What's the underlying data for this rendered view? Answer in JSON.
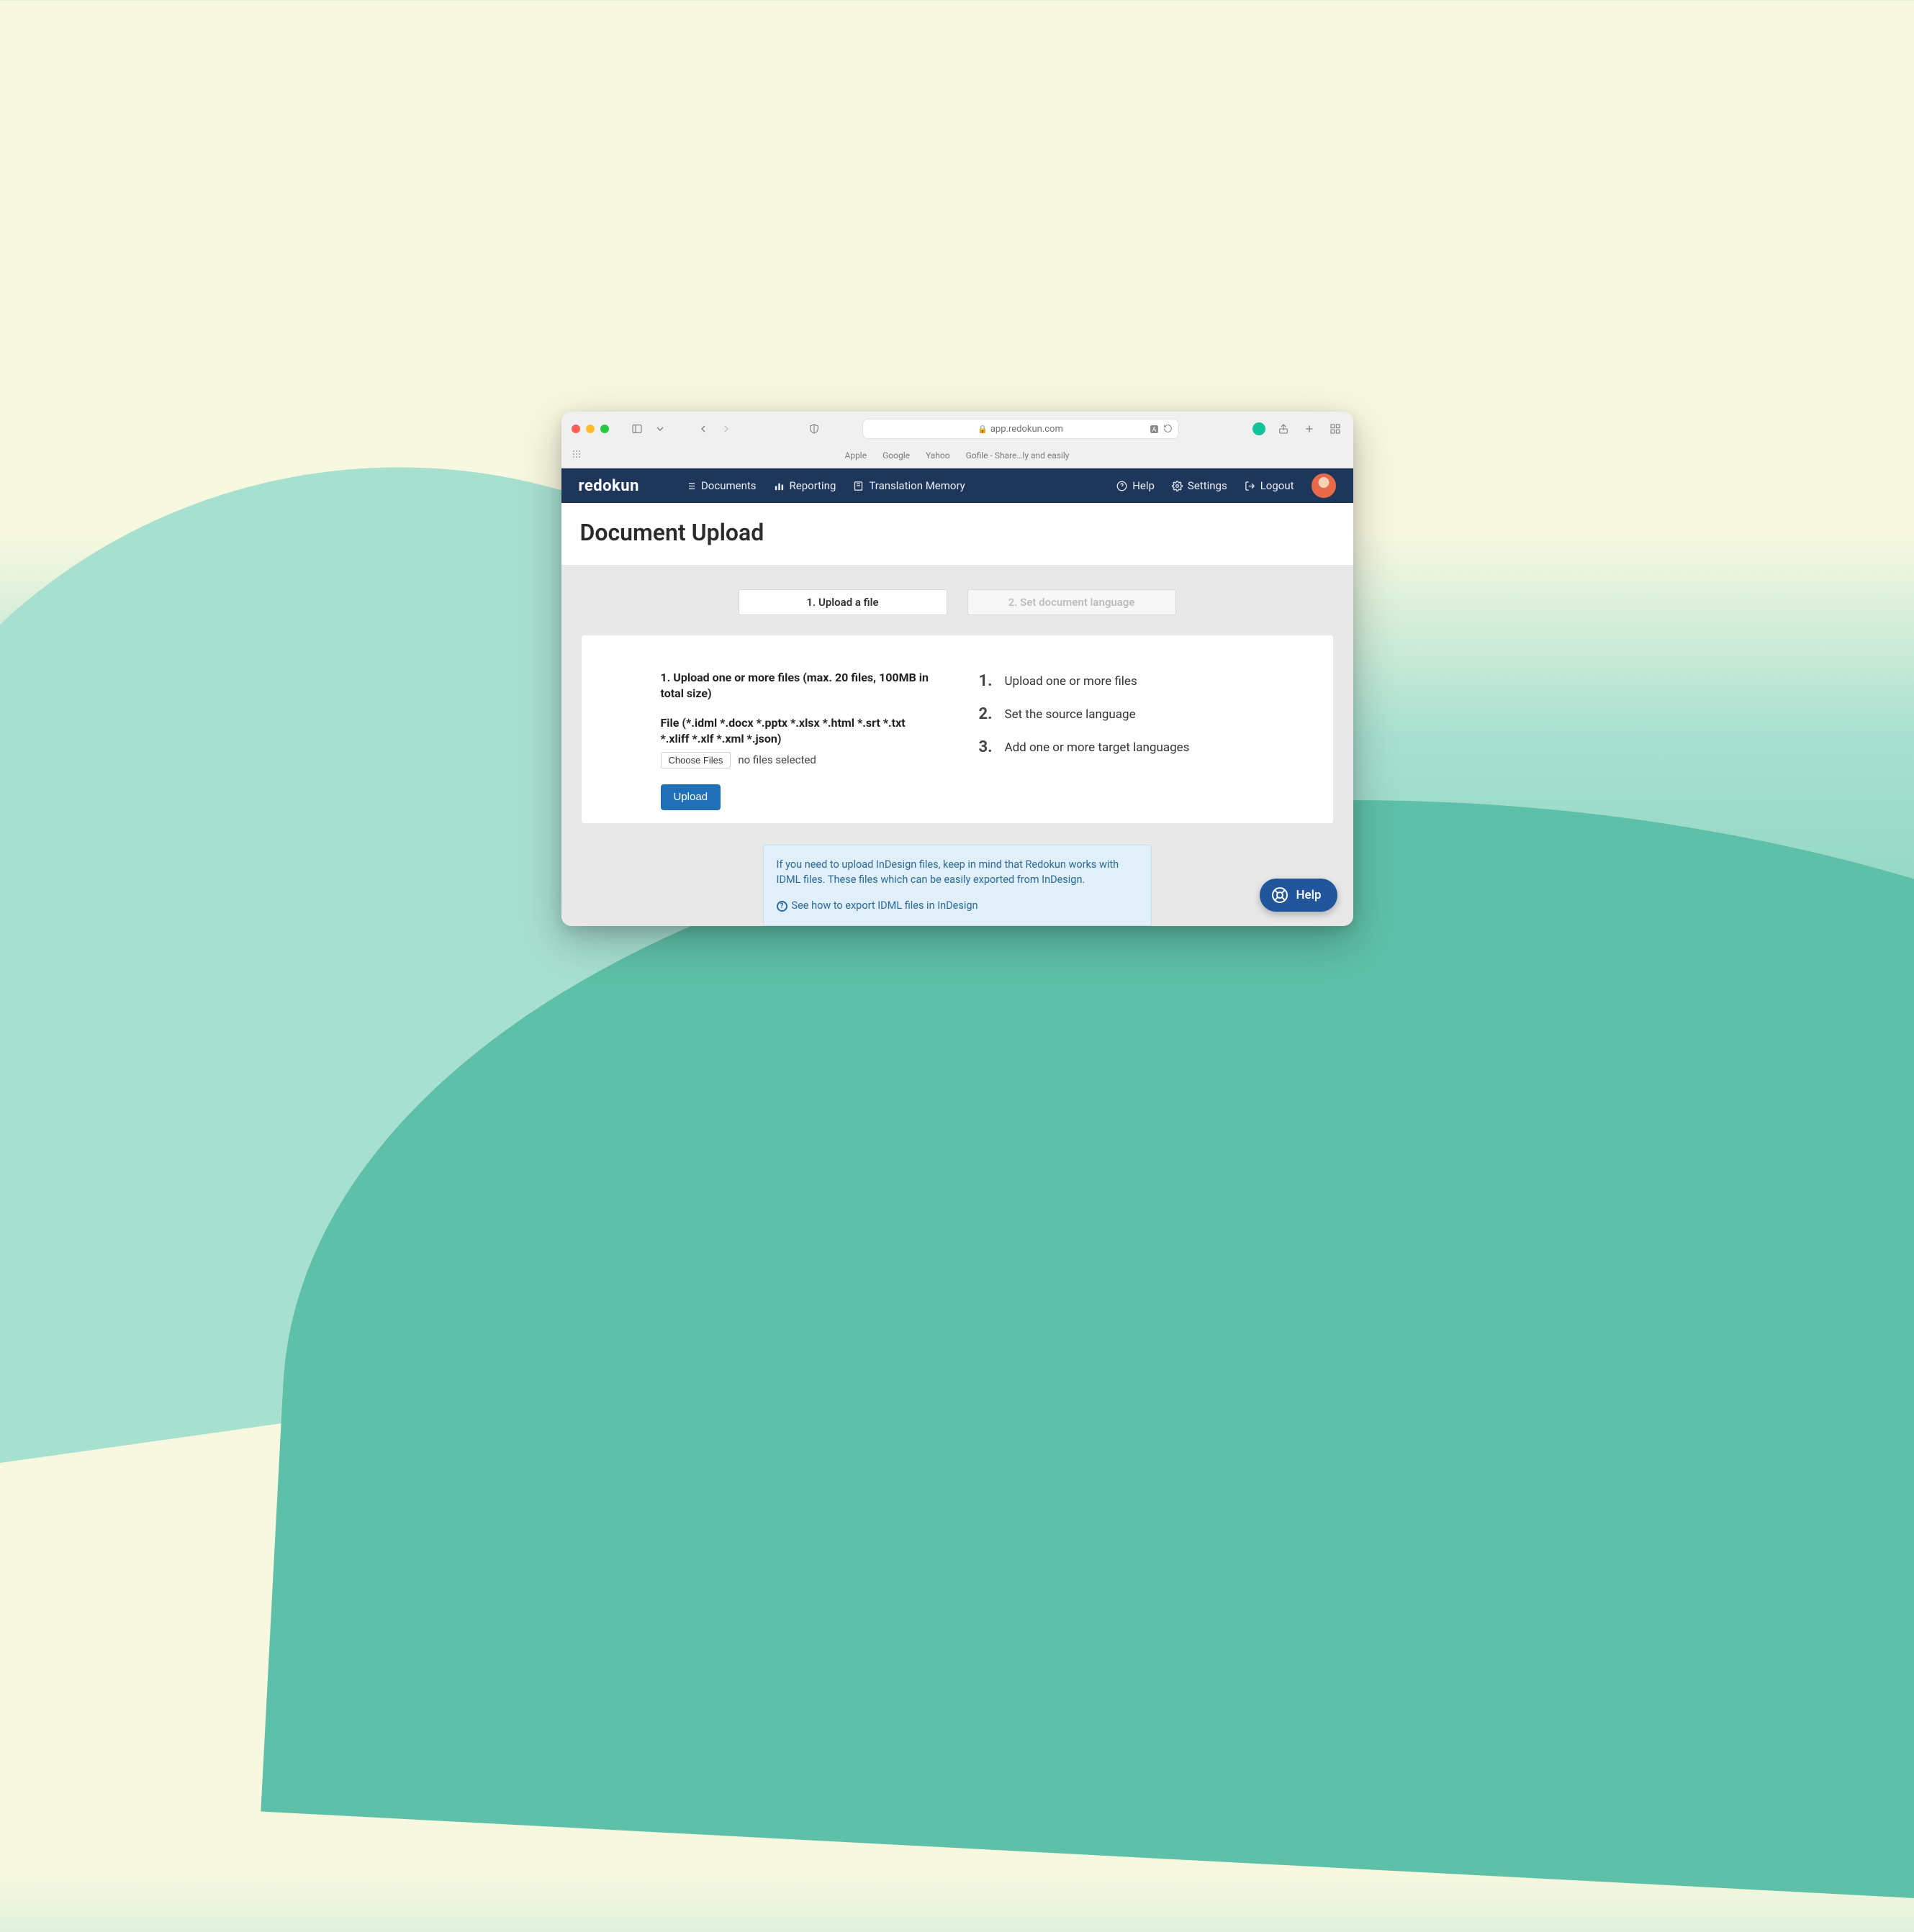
{
  "browser": {
    "url_host": "app.redokun.com",
    "bookmarks": [
      "Apple",
      "Google",
      "Yahoo",
      "Gofile - Share…ly and easily"
    ]
  },
  "nav": {
    "brand": "redokun",
    "items": [
      "Documents",
      "Reporting",
      "Translation Memory"
    ],
    "help": "Help",
    "settings": "Settings",
    "logout": "Logout"
  },
  "page": {
    "title": "Document Upload",
    "tabs": {
      "active": "1. Upload a file",
      "inactive": "2. Set document language"
    },
    "upload": {
      "heading": "1. Upload one or more files (max. 20 files, 100MB in total size)",
      "filetypes": "File (*.idml *.docx *.pptx *.xlsx *.html *.srt *.txt *.xliff *.xlf *.xml *.json)",
      "choose_label": "Choose Files",
      "no_files": "no files selected",
      "upload_btn": "Upload"
    },
    "steps": [
      "Upload one or more files",
      "Set the source language",
      "Add one or more target languages"
    ],
    "info": {
      "text": "If you need to upload InDesign files, keep in mind that Redokun works with IDML files. These files which can be easily exported from InDesign.",
      "link": "See how to export IDML files in InDesign"
    }
  },
  "help_fab": "Help"
}
